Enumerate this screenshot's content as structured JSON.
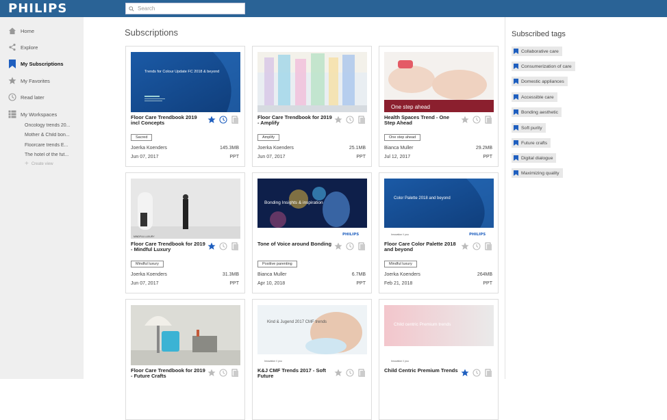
{
  "brand": "PHILIPS",
  "search": {
    "placeholder": "Search",
    "value": ""
  },
  "sidebar": {
    "items": [
      {
        "label": "Home",
        "icon": "home-icon"
      },
      {
        "label": "Explore",
        "icon": "share-icon"
      },
      {
        "label": "My Subscriptions",
        "icon": "bookmark-icon"
      },
      {
        "label": "My Favorites",
        "icon": "star-icon"
      },
      {
        "label": "Read later",
        "icon": "clock-icon"
      },
      {
        "label": "My Workspaces",
        "icon": "grid-icon"
      }
    ],
    "workspaces": [
      "Oncology trends 20...",
      "Mother & Child bon...",
      "Floorcare trends E...",
      "The hotel of the fut..."
    ],
    "create_view": "Create view"
  },
  "main": {
    "title": "Subscriptions",
    "cards": [
      {
        "title": "Floor Care Trendbook 2019 incl Concepts",
        "tag": "Sacred",
        "author": "Joerka Koenders",
        "size": "145.3MB",
        "date": "Jun 07, 2017",
        "type": "PPT",
        "fav": true,
        "later": true,
        "thumb_text": "Trends for Colour Update FC 2018 & beyond"
      },
      {
        "title": "Floor Care Trendbook for 2019 - Amplify",
        "tag": "Amplify",
        "author": "Joerka Koenders",
        "size": "25.1MB",
        "date": "Jun 07, 2017",
        "type": "PPT",
        "fav": false,
        "later": false,
        "thumb_text": ""
      },
      {
        "title": "Health Spaces Trend - One Step Ahead",
        "tag": "One step ahead",
        "author": "Bianca Muller",
        "size": "29.2MB",
        "date": "Jul 12, 2017",
        "type": "PPT",
        "fav": false,
        "later": false,
        "thumb_text": "One step ahead"
      },
      {
        "title": "Floor Care Trendbook for 2019 - Mindful Luxury",
        "tag": "Mindful luxury",
        "author": "Joerka Koenders",
        "size": "31.3MB",
        "date": "Jun 07, 2017",
        "type": "PPT",
        "fav": true,
        "later": false,
        "thumb_text": "MINDFUL LUXURY"
      },
      {
        "title": "Tone of Voice around Bonding",
        "tag": "Positive parenting",
        "author": "Bianca Muller",
        "size": "6.7MB",
        "date": "Apr 10, 2018",
        "type": "PPT",
        "fav": false,
        "later": false,
        "thumb_text": "Bonding Insights & inspiration"
      },
      {
        "title": "Floor Care Color Palette 2018 and beyond",
        "tag": "Mindful luxury",
        "author": "Joerka Koenders",
        "size": "264MB",
        "date": "Feb 21, 2018",
        "type": "PPT",
        "fav": false,
        "later": false,
        "thumb_text": "Color Palette 2018 and beyond"
      },
      {
        "title": "Floor Care Trendbook for 2019 - Future Crafts",
        "tag": "",
        "author": "",
        "size": "",
        "date": "",
        "type": "",
        "fav": false,
        "later": false,
        "thumb_text": ""
      },
      {
        "title": "K&J CMF Trends 2017 - Soft Future",
        "tag": "",
        "author": "",
        "size": "",
        "date": "",
        "type": "",
        "fav": false,
        "later": false,
        "thumb_text": "Kind & Jugend 2017 CMF trends"
      },
      {
        "title": "Child Centric Premium Trends",
        "tag": "",
        "author": "",
        "size": "",
        "date": "",
        "type": "",
        "fav": true,
        "later": false,
        "thumb_text": "Child centric Premium trends"
      }
    ],
    "thumb_brand": "PHILIPS",
    "thumb_footer": "Innovation // you"
  },
  "right": {
    "title": "Subscribed tags",
    "tags": [
      "Collaborative care",
      "Consumerization of care",
      "Domestic appliances",
      "Accessible care",
      "Bonding aesthetic",
      "Soft purity",
      "Future crafts",
      "Digital dialogue",
      "Maximizing quality"
    ]
  },
  "colors": {
    "topbar": "#2a6396",
    "accent": "#1f5fbf",
    "sidebar_bg": "#efefef"
  }
}
